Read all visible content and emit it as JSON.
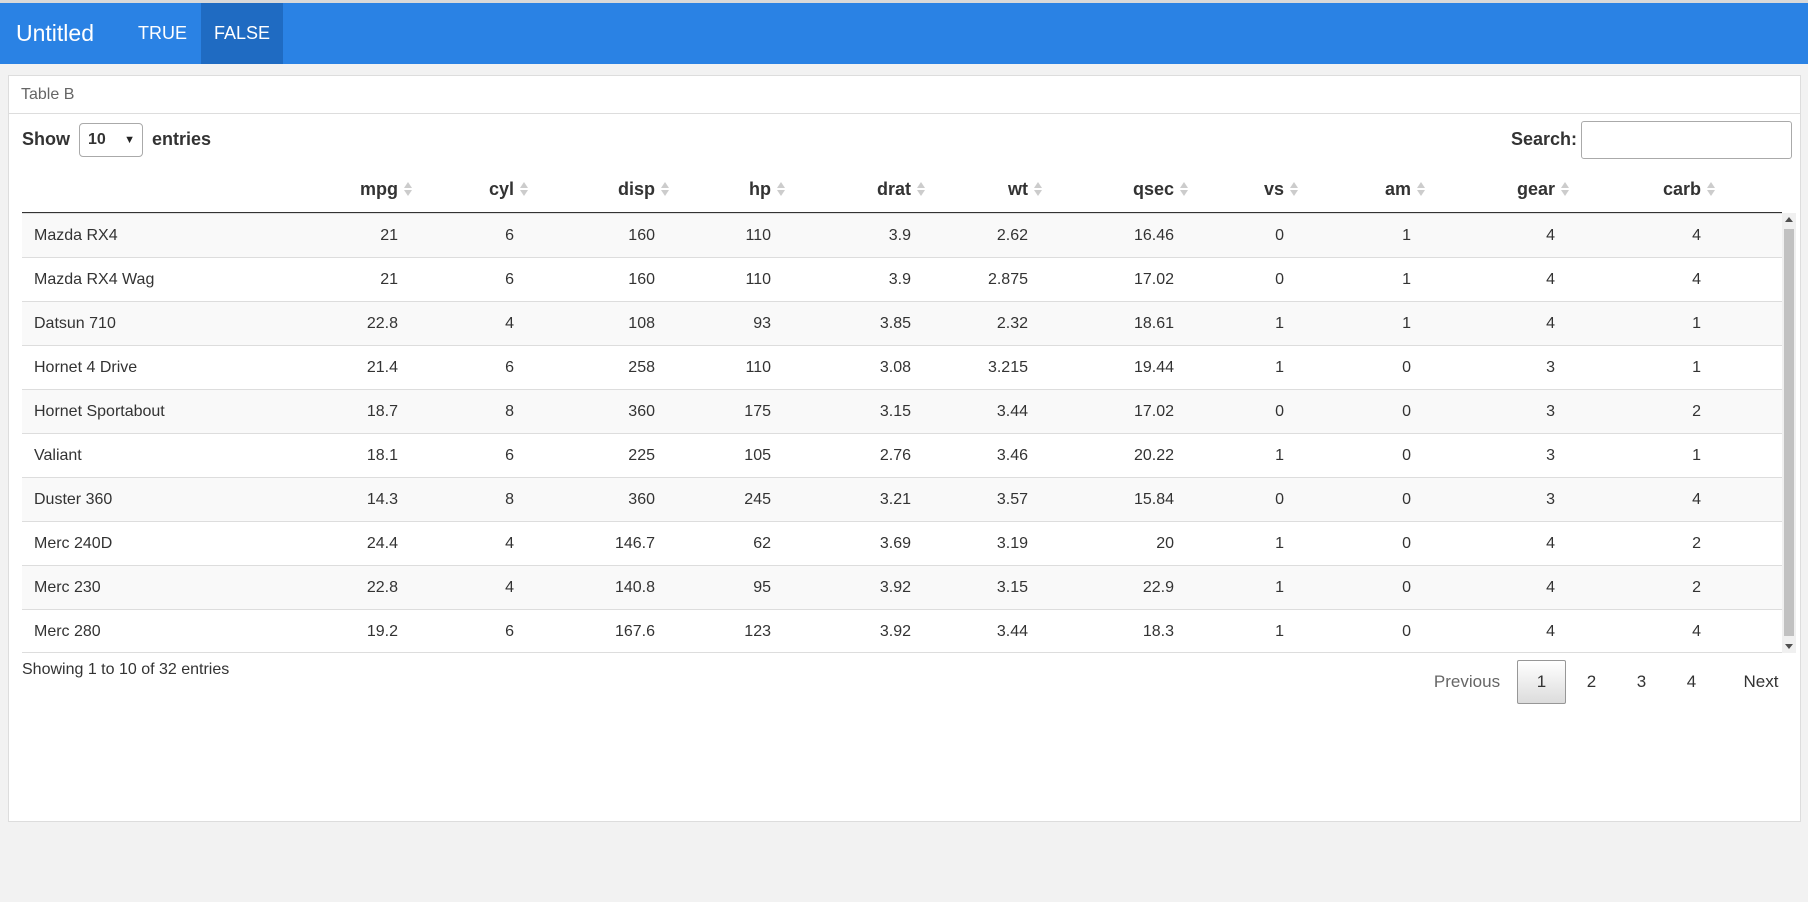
{
  "navbar": {
    "title": "Untitled",
    "tabs": [
      "TRUE",
      "FALSE"
    ],
    "active_tab": "FALSE",
    "color": "#2a82e4",
    "active_color": "#1f6bc2"
  },
  "card": {
    "title": "Table B"
  },
  "controls": {
    "show_label": "Show",
    "entries_value": "10",
    "entries_label": "entries",
    "search_label": "Search:",
    "search_value": ""
  },
  "table": {
    "columns": [
      "",
      "mpg",
      "cyl",
      "disp",
      "hp",
      "drat",
      "wt",
      "qsec",
      "vs",
      "am",
      "gear",
      "carb"
    ],
    "rows": [
      [
        "Mazda RX4",
        "21",
        "6",
        "160",
        "110",
        "3.9",
        "2.62",
        "16.46",
        "0",
        "1",
        "4",
        "4"
      ],
      [
        "Mazda RX4 Wag",
        "21",
        "6",
        "160",
        "110",
        "3.9",
        "2.875",
        "17.02",
        "0",
        "1",
        "4",
        "4"
      ],
      [
        "Datsun 710",
        "22.8",
        "4",
        "108",
        "93",
        "3.85",
        "2.32",
        "18.61",
        "1",
        "1",
        "4",
        "1"
      ],
      [
        "Hornet 4 Drive",
        "21.4",
        "6",
        "258",
        "110",
        "3.08",
        "3.215",
        "19.44",
        "1",
        "0",
        "3",
        "1"
      ],
      [
        "Hornet Sportabout",
        "18.7",
        "8",
        "360",
        "175",
        "3.15",
        "3.44",
        "17.02",
        "0",
        "0",
        "3",
        "2"
      ],
      [
        "Valiant",
        "18.1",
        "6",
        "225",
        "105",
        "2.76",
        "3.46",
        "20.22",
        "1",
        "0",
        "3",
        "1"
      ],
      [
        "Duster 360",
        "14.3",
        "8",
        "360",
        "245",
        "3.21",
        "3.57",
        "15.84",
        "0",
        "0",
        "3",
        "4"
      ],
      [
        "Merc 240D",
        "24.4",
        "4",
        "146.7",
        "62",
        "3.69",
        "3.19",
        "20",
        "1",
        "0",
        "4",
        "2"
      ],
      [
        "Merc 230",
        "22.8",
        "4",
        "140.8",
        "95",
        "3.92",
        "3.15",
        "22.9",
        "1",
        "0",
        "4",
        "2"
      ],
      [
        "Merc 280",
        "19.2",
        "6",
        "167.6",
        "123",
        "3.92",
        "3.44",
        "18.3",
        "1",
        "0",
        "4",
        "4"
      ]
    ]
  },
  "footer": {
    "info": "Showing 1 to 10 of 32 entries",
    "previous_label": "Previous",
    "pages": [
      "1",
      "2",
      "3",
      "4"
    ],
    "current_page": "1",
    "next_label": "Next"
  }
}
